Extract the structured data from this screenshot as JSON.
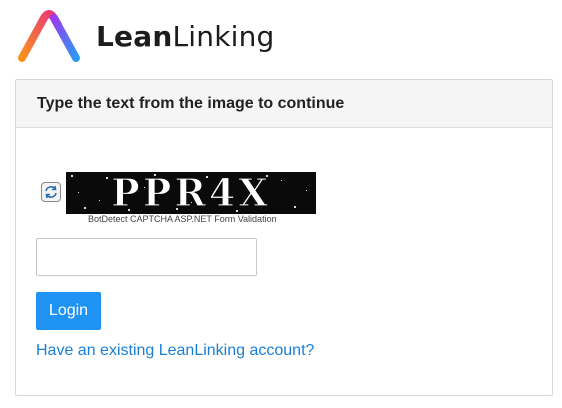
{
  "brand": {
    "name_bold": "Lean",
    "name_light": "Linking"
  },
  "panel": {
    "heading": "Type the text from the image to continue"
  },
  "captcha": {
    "text": "PPR4X",
    "caption": "BotDetect CAPTCHA ASP.NET Form Validation",
    "reload_icon": "reload-icon"
  },
  "form": {
    "input_value": "",
    "input_placeholder": "",
    "login_label": "Login",
    "account_link": "Have an existing LeanLinking account?"
  },
  "colors": {
    "primary": "#1f93f3",
    "link": "#1a7fd4",
    "heading_bg": "#f5f5f5",
    "logo_orange": "#f7931e",
    "logo_pink": "#e8337f",
    "logo_purple": "#7b2ff7",
    "logo_blue": "#2b9af3"
  }
}
